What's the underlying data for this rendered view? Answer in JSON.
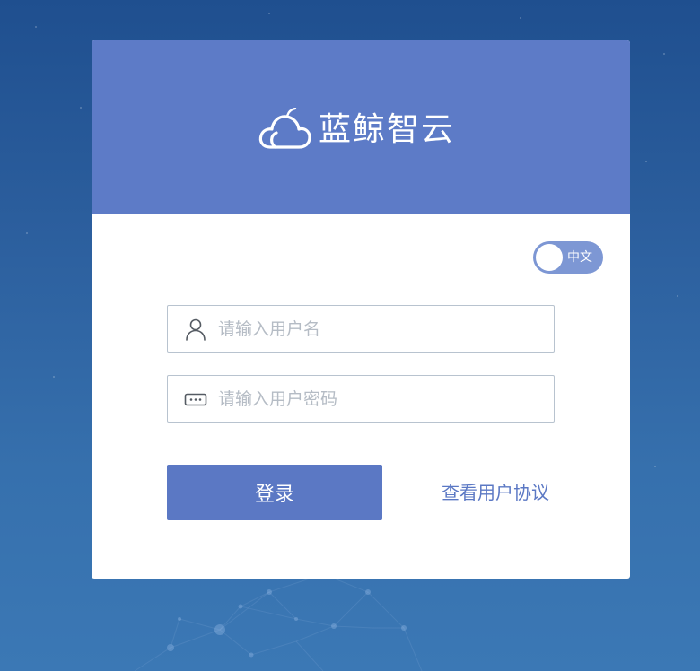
{
  "brand": {
    "name": "蓝鲸智云",
    "logo_icon": "cloud-icon",
    "header_color": "#5d7bc7"
  },
  "language_toggle": {
    "label": "中文"
  },
  "login_form": {
    "username": {
      "placeholder": "请输入用户名",
      "value": "",
      "icon": "user-icon"
    },
    "password": {
      "placeholder": "请输入用户密码",
      "value": "",
      "icon": "password-icon"
    },
    "submit_label": "登录",
    "agreement_link": "查看用户协议"
  },
  "colors": {
    "accent": "#5b78c4",
    "background_top": "#1f4f8f",
    "background_bottom": "#3b78b5",
    "input_border": "#b8c3cf"
  }
}
